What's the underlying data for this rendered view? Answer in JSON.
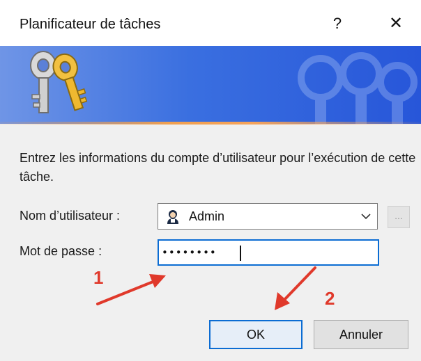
{
  "window": {
    "title": "Planificateur de tâches",
    "help_label": "?",
    "close_label": "✕"
  },
  "banner": {
    "icon": "keys-icon",
    "accent_color": "#2756d9",
    "underline_color": "#f0a050"
  },
  "form": {
    "instruction": "Entrez les informations du compte d’utilisateur pour l’exécution de cette tâche.",
    "username_label": "Nom d’utilisateur :",
    "username_value": "Admin",
    "browse_label": "...",
    "password_label": "Mot de passe :",
    "password_value": "••••••••"
  },
  "buttons": {
    "ok_label": "OK",
    "cancel_label": "Annuler"
  },
  "annotations": {
    "step1": "1",
    "step2": "2",
    "color": "#e0392b"
  }
}
